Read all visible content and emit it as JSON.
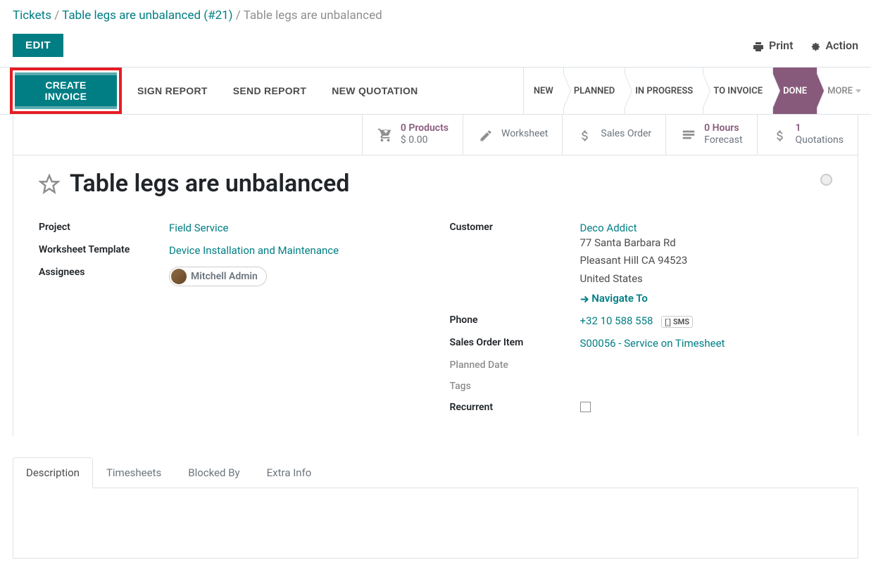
{
  "breadcrumb": {
    "root": "Tickets",
    "parent": "Table legs are unbalanced (#21)",
    "current": "Table legs are unbalanced",
    "sep": " / "
  },
  "header": {
    "edit": "EDIT",
    "print": "Print",
    "action": "Action"
  },
  "actions": {
    "create_invoice": "CREATE INVOICE",
    "sign_report": "SIGN REPORT",
    "send_report": "SEND REPORT",
    "new_quotation": "NEW QUOTATION"
  },
  "status": {
    "new": "NEW",
    "planned": "PLANNED",
    "in_progress": "IN PROGRESS",
    "to_invoice": "TO INVOICE",
    "done": "DONE",
    "more": "MORE"
  },
  "stats": {
    "products": {
      "count": "0 Products",
      "amount": "$ 0.00"
    },
    "worksheet": "Worksheet",
    "sales_order": "Sales Order",
    "hours": {
      "count": "0  Hours",
      "label": "Forecast"
    },
    "quotations": {
      "count": "1",
      "label": "Quotations"
    }
  },
  "title": "Table legs are unbalanced",
  "fields": {
    "project": {
      "label": "Project",
      "value": "Field Service"
    },
    "worksheet_template": {
      "label": "Worksheet Template",
      "value": "Device Installation and Maintenance"
    },
    "assignees": {
      "label": "Assignees",
      "value": "Mitchell Admin"
    },
    "customer": {
      "label": "Customer",
      "name": "Deco Addict",
      "line1": "77 Santa Barbara Rd",
      "line2": "Pleasant Hill CA 94523",
      "line3": "United States",
      "navigate": "Navigate To"
    },
    "phone": {
      "label": "Phone",
      "value": "+32 10 588 558",
      "sms": "SMS"
    },
    "sales_order_item": {
      "label": "Sales Order Item",
      "value": "S00056 - Service on Timesheet"
    },
    "planned_date": {
      "label": "Planned Date"
    },
    "tags": {
      "label": "Tags"
    },
    "recurrent": {
      "label": "Recurrent"
    }
  },
  "tabs": {
    "description": "Description",
    "timesheets": "Timesheets",
    "blocked_by": "Blocked By",
    "extra_info": "Extra Info"
  }
}
